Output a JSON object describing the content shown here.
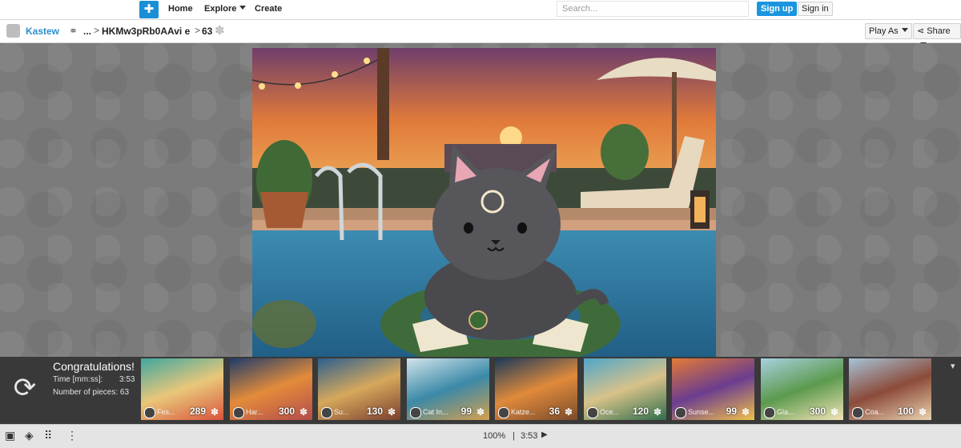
{
  "nav": {
    "logo": "✚",
    "home": "Home",
    "explore": "Explore",
    "create": "Create",
    "search_placeholder": "Search...",
    "signup": "Sign up",
    "signin": "Sign in"
  },
  "breadcrumb": {
    "user": "Kastew",
    "ellipsis": "...",
    "puzzle_id": "HKMw3pRb0AAvi e",
    "pieces": "63",
    "sep": ">",
    "play_as": "Play As",
    "share": "Share"
  },
  "congrats": {
    "title": "Congratulations!",
    "time_label": "Time [mm:ss]:",
    "time_value": "3:53",
    "pieces_label": "Number of pieces: 63",
    "thumbs": [
      {
        "name": "Fes...",
        "count": "289",
        "colors": [
          "#3fa7a0",
          "#e9c77a",
          "#d8553c"
        ]
      },
      {
        "name": "Har...",
        "count": "300",
        "colors": [
          "#1e3c6b",
          "#e38b3a",
          "#b24c4c"
        ]
      },
      {
        "name": "Su...",
        "count": "130",
        "colors": [
          "#2d5f8e",
          "#d6a85c",
          "#7a3f2e"
        ]
      },
      {
        "name": "Cat In...",
        "count": "99",
        "colors": [
          "#d2e4ea",
          "#3b89a8",
          "#d5a04d"
        ]
      },
      {
        "name": "Katze...",
        "count": "36",
        "colors": [
          "#1c3a5a",
          "#e08a3b",
          "#7a4b2a"
        ]
      },
      {
        "name": "Oce...",
        "count": "120",
        "colors": [
          "#4fa6c9",
          "#d8c28a",
          "#2f6e4a"
        ]
      },
      {
        "name": "Sunse...",
        "count": "99",
        "colors": [
          "#e47a35",
          "#6b3d8f",
          "#f1c04b"
        ]
      },
      {
        "name": "Gla...",
        "count": "300",
        "colors": [
          "#a7d1e0",
          "#5c9a4e",
          "#f2e3b5"
        ]
      },
      {
        "name": "Coa...",
        "count": "100",
        "colors": [
          "#a6c3d7",
          "#8c4b3a",
          "#e9d2b0"
        ]
      }
    ]
  },
  "bottombar": {
    "zoom": "100%",
    "divider": "|",
    "timer": "3:53"
  }
}
